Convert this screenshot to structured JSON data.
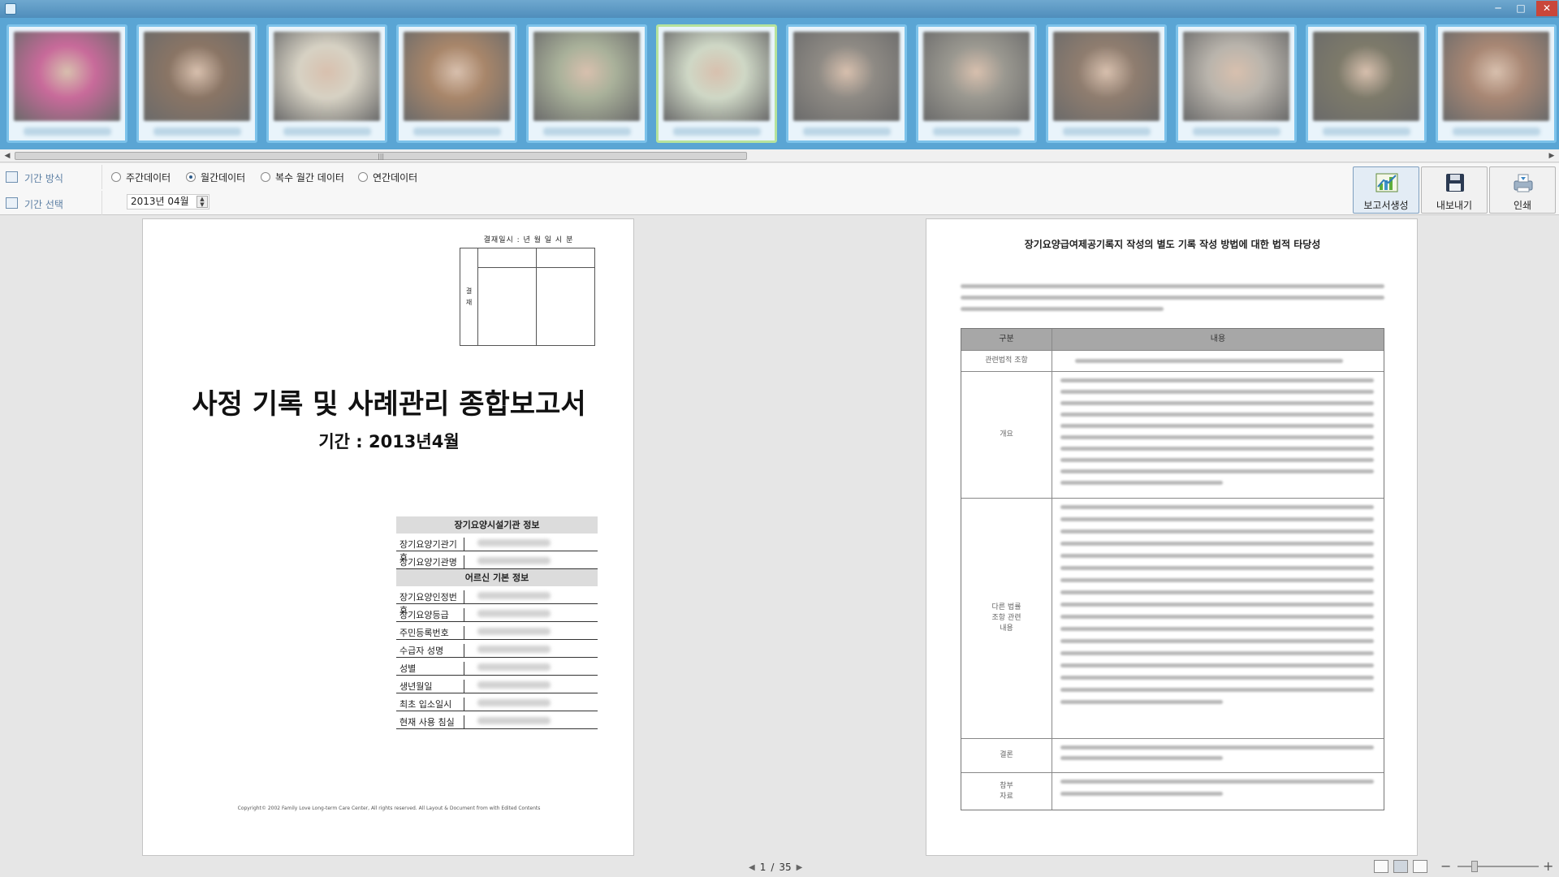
{
  "window": {
    "title": "",
    "min": "─",
    "max": "□",
    "close": "✕"
  },
  "photos": [
    {
      "tone": "#c86a9a"
    },
    {
      "tone": "#8a7565"
    },
    {
      "tone": "#d7d2c4"
    },
    {
      "tone": "#a8866a"
    },
    {
      "tone": "#a9b19a"
    },
    {
      "tone": "#cfd8c6"
    },
    {
      "tone": "#8e8a84"
    },
    {
      "tone": "#9a9890"
    },
    {
      "tone": "#8f7d6f"
    },
    {
      "tone": "#b9b4ac"
    },
    {
      "tone": "#7d7a6a"
    },
    {
      "tone": "#a88774"
    }
  ],
  "toolbar": {
    "period_method_label": "기간 방식",
    "period_select_label": "기간 선택",
    "radios": [
      {
        "label": "주간데이터",
        "checked": false
      },
      {
        "label": "월간데이터",
        "checked": true
      },
      {
        "label": "복수 월간 데이터",
        "checked": false
      },
      {
        "label": "연간데이터",
        "checked": false
      }
    ],
    "period_value": "2013년 04월",
    "buttons": {
      "report": "보고서생성",
      "export": "내보내기",
      "print": "인쇄"
    }
  },
  "left_page": {
    "approval_header": "결재일시 :    년   월   일   시   분",
    "approval_side": "결\n재",
    "title": "사정 기록 및 사례관리 종합보고서",
    "period": "기간 : 2013년4월",
    "section1": "장기요양시설기관 정보",
    "section1_rows": [
      "장기요양기관기호",
      "장기요양기관명"
    ],
    "section2": "어르신 기본 정보",
    "section2_rows": [
      "장기요양인정번호",
      "장기요양등급",
      "주민등록번호",
      "수급자 성명",
      "성별",
      "생년월일",
      "최초 입소일시",
      "현재 사용 침실"
    ],
    "copyright": "Copyright© 2002 Family Love Long-term Care Center, All rights reserved. All Layout & Document from with Edited Contents"
  },
  "right_page": {
    "title": "장기요양급여제공기록지 작성의 별도 기록 작성 방법에 대한 법적 타당성",
    "table_head": [
      "구분",
      "내용"
    ],
    "row_labels": [
      "관련법적 조항",
      "개요",
      "다른 법률\n조항 관련\n내용",
      "결론",
      "참부\n자료"
    ]
  },
  "status": {
    "page_current": "1",
    "page_sep": "/",
    "page_total": "35"
  }
}
